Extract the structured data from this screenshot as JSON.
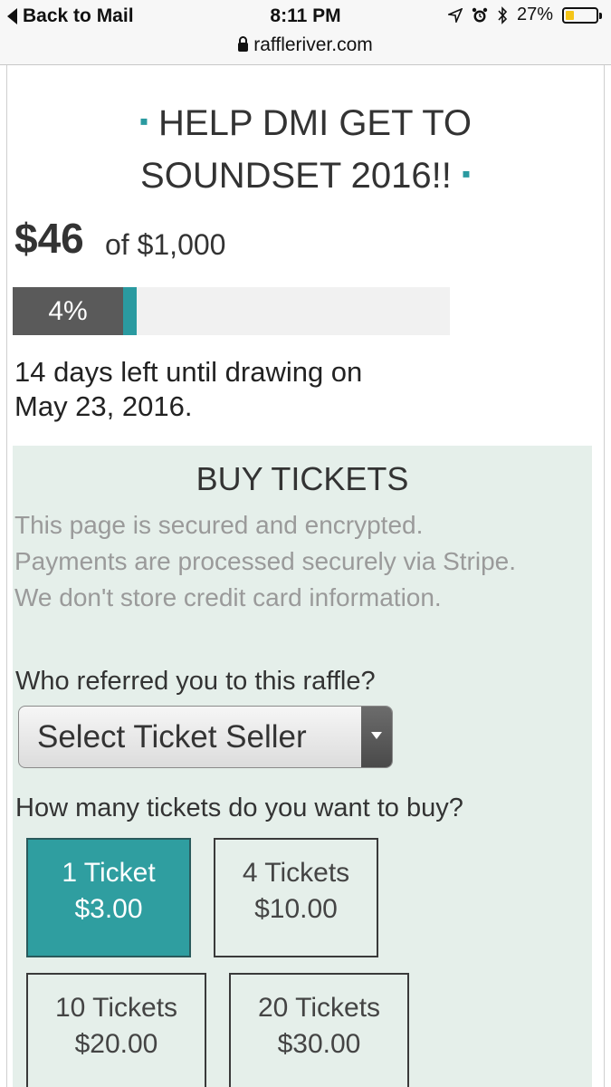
{
  "status_bar": {
    "back_label": "Back to Mail",
    "time": "8:11 PM",
    "battery": "27%",
    "battery_level": 0.27,
    "url": "raffleriver.com",
    "icons": [
      "location-icon",
      "alarm-icon",
      "bluetooth-icon",
      "battery-icon",
      "lock-icon"
    ]
  },
  "raffle": {
    "title": "HELP DMI GET TO SOUNDSET 2016!!",
    "raised": "$46",
    "goal": "of $1,000",
    "progress_label": "4%",
    "progress_fraction": 0.04,
    "days_left": "14 days left until drawing on May 23, 2016."
  },
  "buy": {
    "title": "BUY TICKETS",
    "secure_note": "This page is secured and encrypted. Payments are processed securely via Stripe. We don't store credit card information.",
    "referral_label": "Who referred you to this raffle?",
    "seller_select": "Select Ticket Seller",
    "quantity_label": "How many tickets do you want to buy?",
    "options": [
      {
        "tickets": "1 Ticket",
        "price": "$3.00",
        "selected": true
      },
      {
        "tickets": "4 Tickets",
        "price": "$10.00",
        "selected": false
      },
      {
        "tickets": "10 Tickets",
        "price": "$20.00",
        "selected": false
      },
      {
        "tickets": "20 Tickets",
        "price": "$30.00",
        "selected": false
      }
    ]
  },
  "colors": {
    "accent": "#2a9aa0",
    "selected_ticket": "#2f9ea0",
    "panel_bg": "#e5efea",
    "progress_dark": "#5a5a5a"
  }
}
